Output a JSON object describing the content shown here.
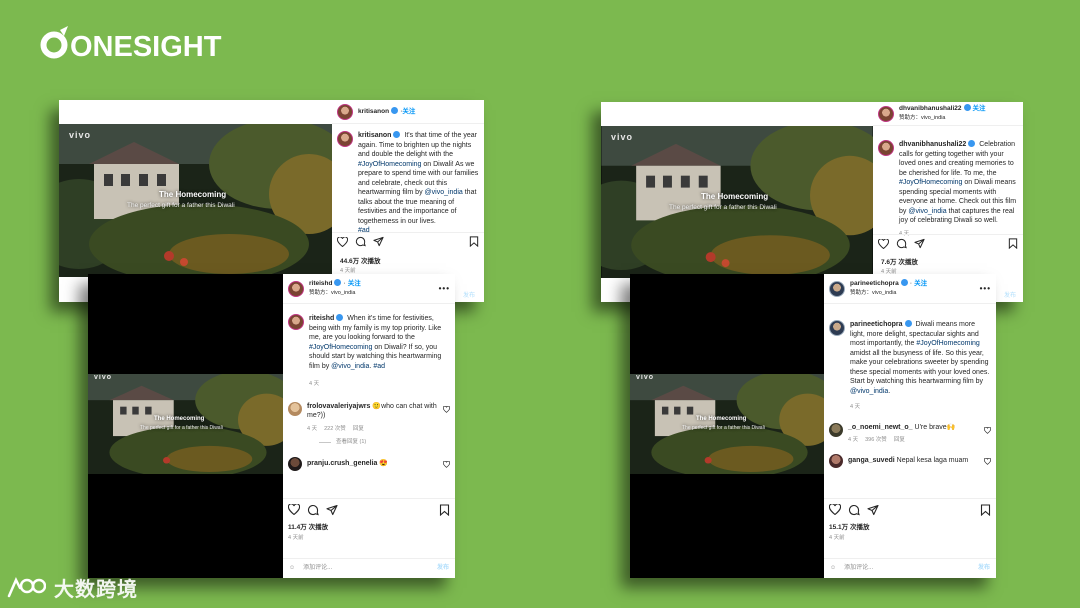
{
  "brand": {
    "logo_text": "ONESIGHT",
    "bottom_text": "大数跨境"
  },
  "video": {
    "logo": "vivo",
    "title": "The Homecoming",
    "subtitle": "The perfect gift for a father this Diwali"
  },
  "common": {
    "follow": "关注",
    "sponsored_label": "赞助方：",
    "sponsor_handle": "vivo_india",
    "add_comment_placeholder": "添加评论...",
    "post_label": "发布",
    "more": "•••"
  },
  "posts": {
    "kriti": {
      "username": "kritisanon",
      "caption_pre": "It's that time of the year again. Time to brighten up the nights and double the delight with the ",
      "hashtag": "#JoyOfHomecoming",
      "caption_mid": " on Diwali! As we prepare to spend time with our families and celebrate, check out this heartwarming film by ",
      "mention": "@vivo_india",
      "caption_post": " that talks about the true meaning of festivities and the importance of togetherness in our lives.",
      "tag2": "#ad",
      "views": "44.6万 次播放",
      "age": "4 天前"
    },
    "riteish": {
      "username": "riteishd",
      "caption_pre": "When it's time for festivities, being with my family is my top priority. Like me, are you looking forward to the ",
      "hashtag": "#JoyOfHomecoming",
      "caption_mid": " on Diwali? If so, you should start by watching this heartwarming film by ",
      "mention": "@vivo_india",
      "caption_post": ". ",
      "tag2": "#ad",
      "caption_age": "4 天",
      "comment1_user": "frolovavaleriyajwrs",
      "comment1_text": "🙂who can chat with me?))",
      "comment1_age": "4 天",
      "comment1_likes": "222 次赞",
      "comment1_reply": "回复",
      "view_replies": "查看回复 (1)",
      "comment2_user": "pranju.crush_genelia",
      "comment2_text": "😍",
      "views": "11.4万 次播放",
      "age": "4 天前"
    },
    "dhvani": {
      "username": "dhvanibhanushali22",
      "caption": "Celebration calls for getting together with your loved ones and creating memories to be cherished for life. To me, the ",
      "hashtag": "#JoyOfHomecoming",
      "caption_mid": " on Diwali means spending special moments with everyone at home. Check out this film by ",
      "mention": "@vivo_india",
      "caption_post": " that captures the real joy of celebrating Diwali so well.",
      "caption_age": "4 天",
      "views": "7.6万 次播放",
      "age": "4 天前"
    },
    "parineeti": {
      "username": "parineetichopra",
      "caption_pre": "Diwali means more light, more delight, spectacular sights and most importantly, the ",
      "hashtag": "#JoyOfHomecoming",
      "caption_mid": " amidst all the busyness of life. So this year, make your celebrations sweeter by spending these special moments with your loved ones.",
      "caption_line2": "Start by watching this heartwarming film by ",
      "mention": "@vivo_india",
      "caption_post": ".",
      "caption_age": "4 天",
      "comment1_user": "_o_noemi_newt_o_",
      "comment1_text": "U're brave🙌",
      "comment1_age": "4 天",
      "comment1_likes": "396 次赞",
      "comment1_reply": "回复",
      "comment2_user": "ganga_suvedi",
      "comment2_text": "Nepal kesa laga muam",
      "views": "15.1万 次播放",
      "age": "4 天前"
    }
  },
  "colors": {
    "background": "#7cb94f",
    "link": "#00376b",
    "follow": "#0095f6"
  }
}
